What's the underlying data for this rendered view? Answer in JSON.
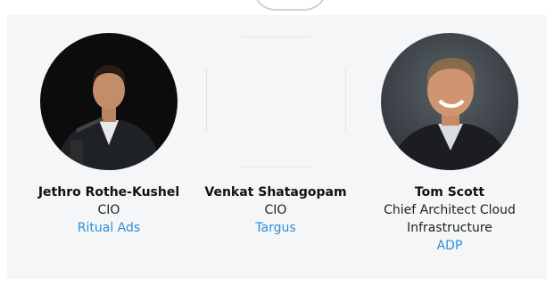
{
  "people": [
    {
      "name": "Jethro Rothe-Kushel",
      "role": "CIO",
      "company": "Ritual Ads"
    },
    {
      "name": "Venkat Shatagopam",
      "role": "CIO",
      "company": "Targus"
    },
    {
      "name": "Tom Scott",
      "role_line1": "Chief Architect Cloud",
      "role_line2": "Infrastructure",
      "company": "ADP"
    }
  ],
  "colors": {
    "link": "#2f8ed8",
    "panel": "#f4f6f7"
  }
}
